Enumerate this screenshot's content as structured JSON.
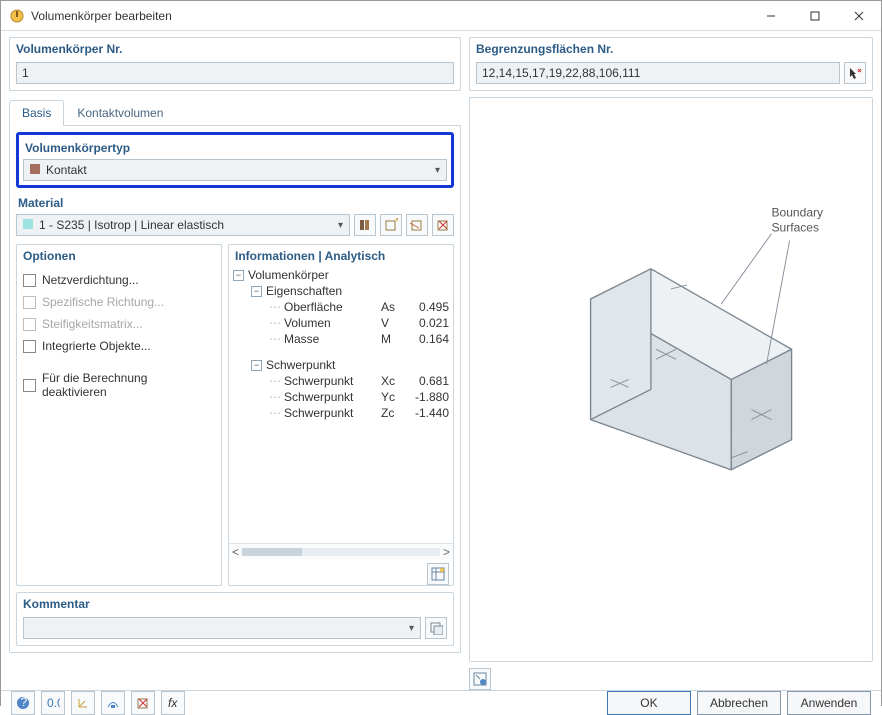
{
  "titlebar": {
    "title": "Volumenkörper bearbeiten"
  },
  "solid_no": {
    "label": "Volumenkörper Nr.",
    "value": "1"
  },
  "surfaces": {
    "label": "Begrenzungsflächen Nr.",
    "value": "12,14,15,17,19,22,88,106,111"
  },
  "tabs": {
    "basic": "Basis",
    "contact": "Kontaktvolumen"
  },
  "type": {
    "label": "Volumenkörpertyp",
    "value": "Kontakt"
  },
  "material": {
    "label": "Material",
    "value": "1 - S235 | Isotrop | Linear elastisch"
  },
  "options": {
    "label": "Optionen",
    "mesh": "Netzverdichtung...",
    "dir": "Spezifische Richtung...",
    "stiff": "Steifigkeitsmatrix...",
    "integ": "Integrierte Objekte...",
    "deact": "Für die Berechnung deaktivieren"
  },
  "info": {
    "label": "Informationen | Analytisch",
    "root": "Volumenkörper",
    "props": "Eigenschaften",
    "surface": {
      "l": "Oberfläche",
      "s": "As",
      "v": "0.495"
    },
    "volume": {
      "l": "Volumen",
      "s": "V",
      "v": "0.021"
    },
    "mass": {
      "l": "Masse",
      "s": "M",
      "v": "0.164"
    },
    "cog": "Schwerpunkt",
    "xc": {
      "l": "Schwerpunkt",
      "s": "Xc",
      "v": "0.681"
    },
    "yc": {
      "l": "Schwerpunkt",
      "s": "Yc",
      "v": "-1.880"
    },
    "zc": {
      "l": "Schwerpunkt",
      "s": "Zc",
      "v": "-1.440"
    }
  },
  "comment": {
    "label": "Kommentar"
  },
  "preview": {
    "annot": "Boundary\nSurfaces"
  },
  "buttons": {
    "ok": "OK",
    "cancel": "Abbrechen",
    "apply": "Anwenden"
  }
}
